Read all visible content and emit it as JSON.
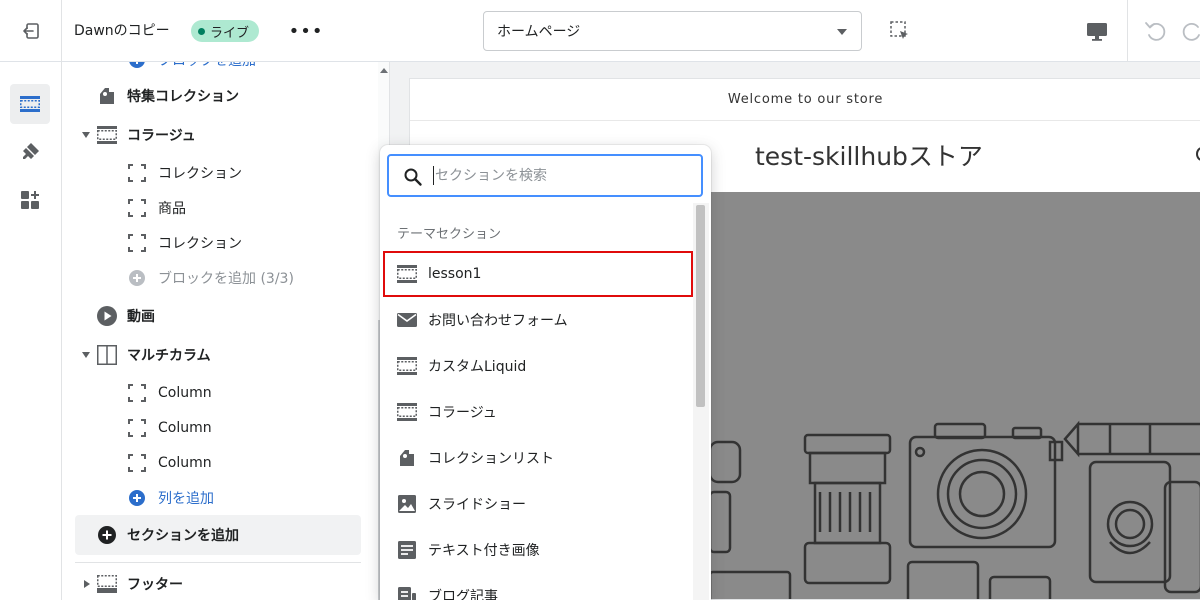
{
  "topbar": {
    "theme_name": "Dawnのコピー",
    "status_badge": "ライブ",
    "more_label": "•••",
    "page_select": {
      "value": "ホームページ"
    }
  },
  "sidebar": {
    "items": [
      {
        "id": "add-block-top",
        "label": "ブロックを追加"
      },
      {
        "id": "featured-collection",
        "label": "特集コレクション"
      },
      {
        "id": "collage",
        "label": "コラージュ"
      },
      {
        "id": "collage-collection-1",
        "label": "コレクション"
      },
      {
        "id": "collage-product",
        "label": "商品"
      },
      {
        "id": "collage-collection-2",
        "label": "コレクション"
      },
      {
        "id": "collage-add-block",
        "label": "ブロックを追加 (3/3)"
      },
      {
        "id": "video",
        "label": "動画"
      },
      {
        "id": "multicolumn",
        "label": "マルチカラム"
      },
      {
        "id": "column-1",
        "label": "Column"
      },
      {
        "id": "column-2",
        "label": "Column"
      },
      {
        "id": "column-3",
        "label": "Column"
      },
      {
        "id": "add-column",
        "label": "列を追加"
      },
      {
        "id": "add-section",
        "label": "セクションを追加"
      },
      {
        "id": "footer",
        "label": "フッター"
      }
    ]
  },
  "preview": {
    "announcement": "Welcome to our store",
    "store_name": "test-skillhubストア"
  },
  "popover": {
    "search_placeholder": "セクションを検索",
    "heading": "テーマセクション",
    "items": [
      {
        "label": "lesson1",
        "icon": "section-icon",
        "highlighted": true
      },
      {
        "label": "お問い合わせフォーム",
        "icon": "mail-icon"
      },
      {
        "label": "カスタムLiquid",
        "icon": "section-icon"
      },
      {
        "label": "コラージュ",
        "icon": "section-icon"
      },
      {
        "label": "コレクションリスト",
        "icon": "collection-tag-icon"
      },
      {
        "label": "スライドショー",
        "icon": "image-icon"
      },
      {
        "label": "テキスト付き画像",
        "icon": "text-block-icon"
      },
      {
        "label": "ブログ記事",
        "icon": "blog-icon"
      }
    ]
  },
  "colors": {
    "accent": "#2c6ecb",
    "live_badge_bg": "#aee9d1",
    "live_dot": "#007f5f",
    "focus_ring": "#458fff",
    "highlight_outline": "#e00b0b"
  }
}
